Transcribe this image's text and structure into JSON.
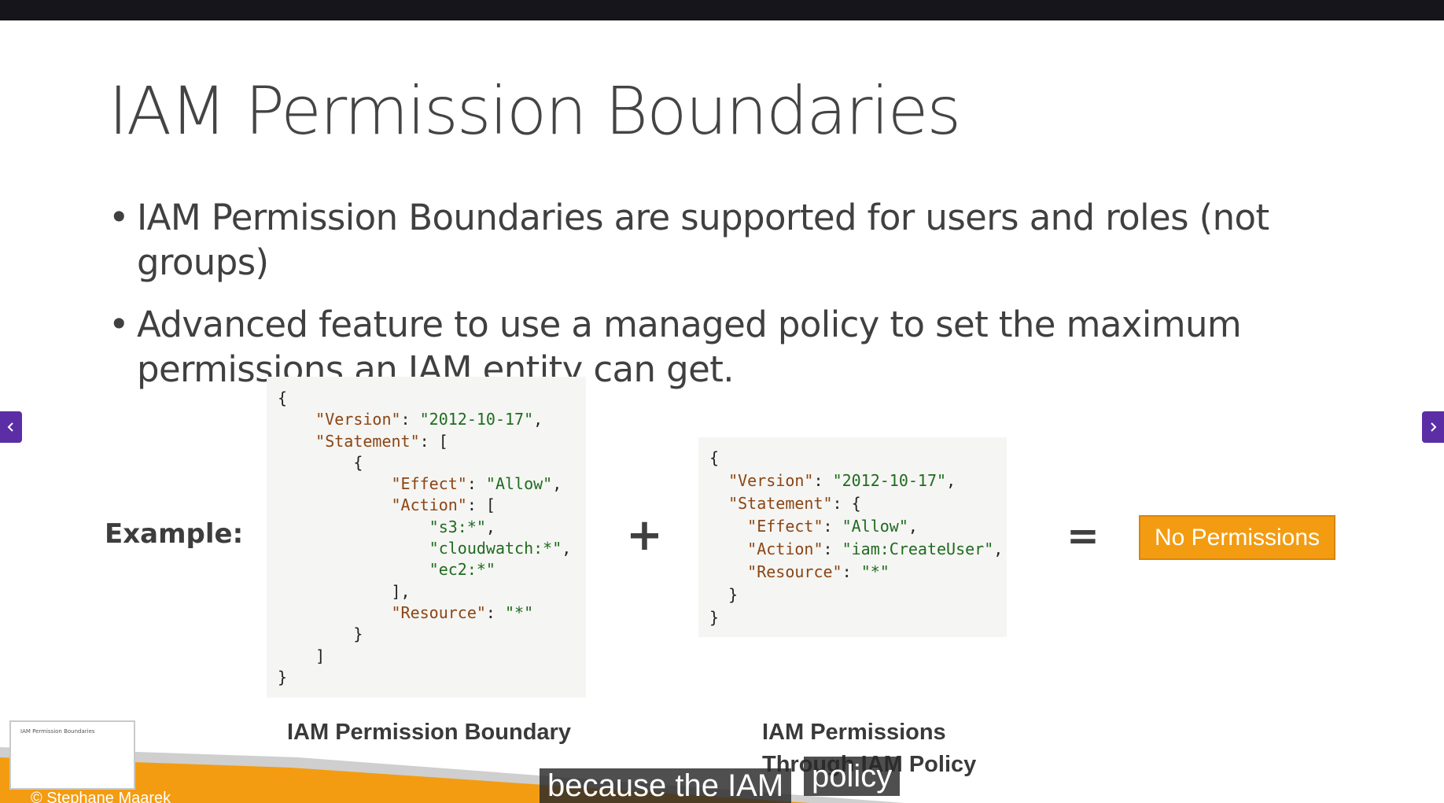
{
  "slide": {
    "title": "IAM Permission Boundaries",
    "bullets": [
      "IAM Permission Boundaries are supported for users and roles (not groups)",
      "Advanced feature to use a managed policy to set the maximum permissions an IAM entity can get."
    ],
    "example_label": "Example:",
    "plus_symbol": "+",
    "equals_symbol": "=",
    "result_label": "No Permissions",
    "caption_boundary": "IAM Permission Boundary",
    "caption_policy": "IAM Permissions Through IAM Policy",
    "copyright": "© Stephane Maarek",
    "thumbnail_title": "IAM Permission Boundaries"
  },
  "policy_boundary": {
    "version_key": "\"Version\"",
    "version_value": "\"2012-10-17\"",
    "statement_key": "\"Statement\"",
    "effect_key": "\"Effect\"",
    "effect_value": "\"Allow\"",
    "action_key": "\"Action\"",
    "actions": [
      "\"s3:*\"",
      "\"cloudwatch:*\"",
      "\"ec2:*\""
    ],
    "resource_key": "\"Resource\"",
    "resource_value": "\"*\""
  },
  "policy_iam": {
    "version_key": "\"Version\"",
    "version_value": "\"2012-10-17\"",
    "statement_key": "\"Statement\"",
    "effect_key": "\"Effect\"",
    "effect_value": "\"Allow\"",
    "action_key": "\"Action\"",
    "action_value": "\"iam:CreateUser\"",
    "resource_key": "\"Resource\"",
    "resource_value": "\"*\""
  },
  "subtitles": {
    "line1": "because the IAM",
    "line2": "policy"
  },
  "nav": {
    "prev_icon": "chevron-left-icon",
    "next_icon": "chevron-right-icon"
  },
  "colors": {
    "accent_orange": "#f39c12",
    "nav_purple": "#5b2ea6",
    "topbar": "#15151b"
  }
}
